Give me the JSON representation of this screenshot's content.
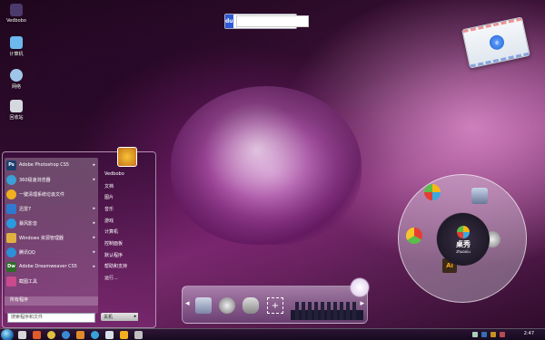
{
  "desktop_icons": [
    {
      "label": "Vedbobo",
      "color": "#4b3a6a"
    },
    {
      "label": "计算机",
      "color": "#6db8ec"
    },
    {
      "label": "网络",
      "color": "#9fc6e8"
    },
    {
      "label": "回收站",
      "color": "#d5d9de"
    }
  ],
  "search": {
    "logo": "du",
    "placeholder": ""
  },
  "mail": {
    "badge": "e"
  },
  "start_menu": {
    "left_items": [
      {
        "label": "Adobe Photoshop CS5",
        "icon": "Ps",
        "color": "#1e3f6e",
        "has_arrow": true
      },
      {
        "label": "360极速浏览器",
        "icon": "",
        "color": "#39a0d8",
        "has_arrow": true
      },
      {
        "label": "一键清理系统垃圾文件",
        "icon": "",
        "color": "#f0b020",
        "has_arrow": false
      },
      {
        "label": "迅雷7",
        "icon": "",
        "color": "#2f7ad0",
        "has_arrow": true
      },
      {
        "label": "暴风影音",
        "icon": "",
        "color": "#2a9ae0",
        "has_arrow": true
      },
      {
        "label": "Windows 资源管理器",
        "icon": "",
        "color": "#e0b040",
        "has_arrow": true
      },
      {
        "label": "腾讯QQ",
        "icon": "",
        "color": "#2d8fd6",
        "has_arrow": true
      },
      {
        "label": "Adobe Dreamweaver CS5",
        "icon": "Dw",
        "color": "#2f6b2a",
        "has_arrow": true
      },
      {
        "label": "截图工具",
        "icon": "",
        "color": "#c94a8d",
        "has_arrow": false
      }
    ],
    "all_programs": "所有程序",
    "search_placeholder": "搜索程序和文件",
    "right_items": [
      "Vedbobo",
      "文档",
      "图片",
      "音乐",
      "游戏",
      "计算机",
      "控制面板",
      "默认程序",
      "帮助和支持",
      "运行..."
    ],
    "shutdown": "关机",
    "shutdown_arrow": "▸"
  },
  "dock": {
    "left_arrow": "◂",
    "right_arrow": "▸",
    "plus": "+"
  },
  "launcher": {
    "title": "桌秀",
    "subtitle": "zhuoxiu",
    "ai_label": "Ai"
  },
  "taskbar": {
    "clock": "2:47"
  }
}
